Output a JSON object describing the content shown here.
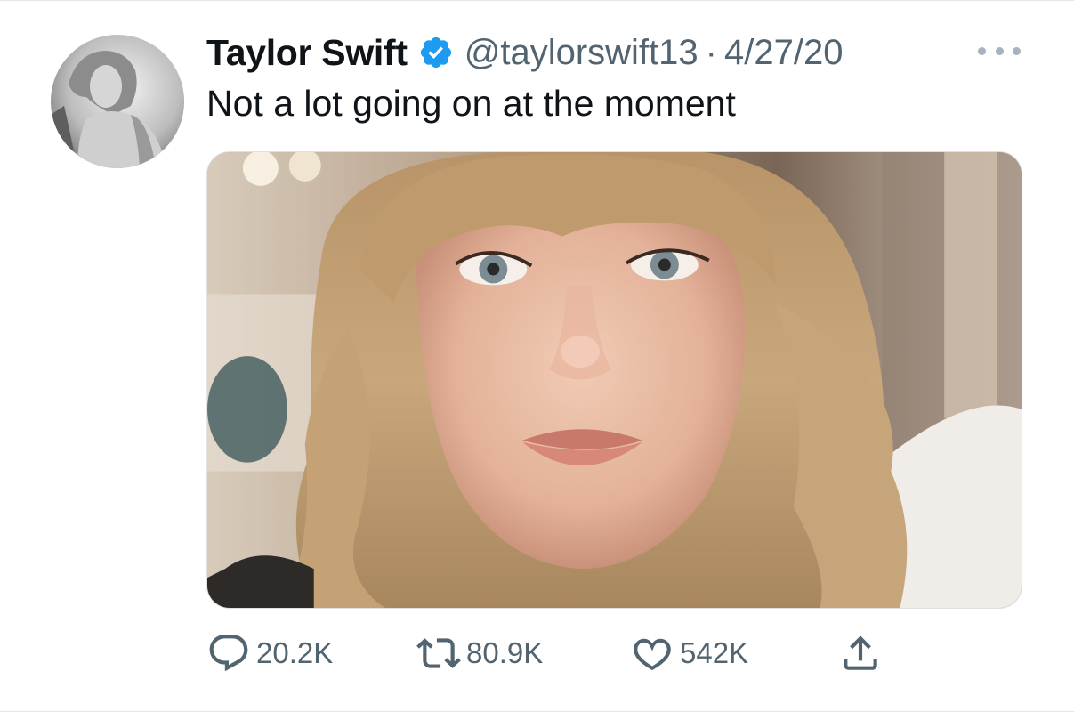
{
  "tweet": {
    "author_name": "Taylor Swift",
    "handle": "@taylorswift13",
    "separator": "·",
    "date": "4/27/20",
    "text": "Not a lot going on at the moment",
    "verified": true,
    "media_description_icon": "photo"
  },
  "actions": {
    "reply_count": "20.2K",
    "retweet_count": "80.9K",
    "like_count": "542K"
  },
  "icons": {
    "verified": "verified-badge-icon",
    "more": "more-options-icon",
    "reply": "reply-icon",
    "retweet": "retweet-icon",
    "like": "heart-icon",
    "share": "share-icon"
  },
  "colors": {
    "verified_blue": "#1d9bf0",
    "secondary_text": "#536471",
    "primary_text": "#0f1419"
  }
}
